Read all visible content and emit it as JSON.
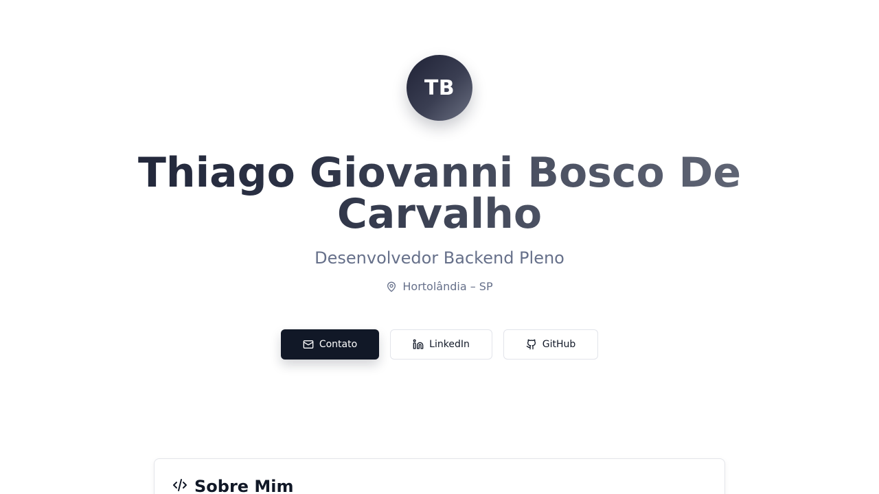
{
  "profile": {
    "initials": "TB",
    "name": "Thiago Giovanni Bosco De Carvalho",
    "role": "Desenvolvedor Backend Pleno",
    "location": "Hortolândia – SP",
    "location_icon": "map-pin-icon"
  },
  "actions": {
    "contact_label": "Contato",
    "contact_icon": "mail-icon",
    "linkedin_label": "LinkedIn",
    "linkedin_icon": "linkedin-icon",
    "github_label": "GitHub",
    "github_icon": "github-icon"
  },
  "about": {
    "title": "Sobre Mim",
    "icon": "code-icon"
  },
  "colors": {
    "primary_button": "#111827",
    "muted_text": "#66708a",
    "avatar_gradient_start": "#1f2236",
    "avatar_gradient_end": "#6b7082"
  }
}
